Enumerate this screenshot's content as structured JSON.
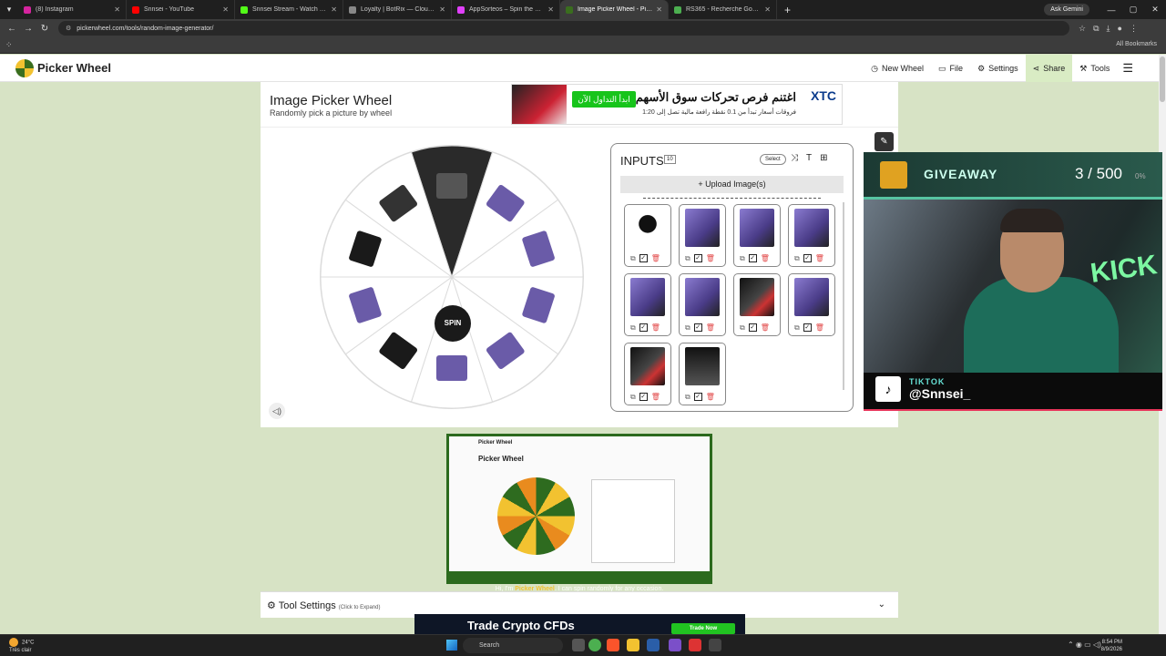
{
  "browser": {
    "tabs": [
      {
        "label": "(8) Instagram",
        "color": "#d6249f"
      },
      {
        "label": "Snnsei - YouTube",
        "color": "#ff0000"
      },
      {
        "label": "Snnsei Stream - Watch Live on Kick",
        "color": "#53fc18"
      },
      {
        "label": "Loyalty | BotRix — Cloud Stream Bot",
        "color": "#888888"
      },
      {
        "label": "AppSorteos – Spin the Wheel Online",
        "color": "#e040fb"
      },
      {
        "label": "Image Picker Wheel - Pick a Random Image",
        "color": "#3a6e1e"
      },
      {
        "label": "RS365 - Recherche Google",
        "color": "#4caf50"
      }
    ],
    "active_tab": 5,
    "ask_gemini": "Ask Gemini",
    "url": "pickerwheel.com/tools/random-image-generator/",
    "all_bookmarks": "All Bookmarks"
  },
  "site": {
    "logo": "Picker Wheel",
    "menu": [
      {
        "label": "New Wheel",
        "icon": "history-icon"
      },
      {
        "label": "File",
        "icon": "file-icon"
      },
      {
        "label": "Settings",
        "icon": "gear-icon"
      },
      {
        "label": "Share",
        "icon": "share-icon"
      },
      {
        "label": "Tools",
        "icon": "tools-icon"
      }
    ]
  },
  "page": {
    "title": "Image Picker Wheel",
    "subtitle": "Randomly pick a picture by wheel"
  },
  "ad_top": {
    "button": "ابدأ التداول الآن",
    "headline": "اغتنم فرص تحركات سوق الأسهم",
    "sub": "فروقات أسعار تبدأ من 0.1 نقطة  رافعة مالية تصل إلى 1:20",
    "brand": "XTC"
  },
  "wheel": {
    "spin_label": "SPIN",
    "segments": 10,
    "highlighted_segment": 0
  },
  "inputs": {
    "title": "INPUTS",
    "count": "10",
    "select_label": "Select",
    "upload_label": "+ Upload Image(s)",
    "items": [
      {
        "kind": "mouse",
        "checked": true
      },
      {
        "kind": "setup",
        "checked": true
      },
      {
        "kind": "setup",
        "checked": true
      },
      {
        "kind": "setup",
        "checked": true
      },
      {
        "kind": "setup",
        "checked": true
      },
      {
        "kind": "setup",
        "checked": true
      },
      {
        "kind": "pc",
        "checked": true
      },
      {
        "kind": "setup",
        "checked": true
      },
      {
        "kind": "pc",
        "checked": true
      },
      {
        "kind": "mouse-box",
        "checked": true
      }
    ]
  },
  "giveaway": {
    "label": "GIVEAWAY",
    "count": "3 / 500",
    "percent": "0%",
    "progress": 0.006
  },
  "tiktok": {
    "platform": "TIKTOK",
    "handle": "@Snnsei_"
  },
  "video": {
    "logo": "Picker Wheel",
    "title": "Picker Wheel",
    "caption_pre": "Hi, I'm ",
    "caption_brand": "Picker Wheel",
    "caption_post": ". I can spin randomly for any occasion."
  },
  "tool_settings": {
    "label": "Tool Settings",
    "hint": "(Click to Expand)"
  },
  "ad_bottom": {
    "text": "Trade Crypto CFDs",
    "button": "Trade Now"
  },
  "taskbar": {
    "temp": "24°C",
    "weather": "Très clair",
    "search": "Search",
    "time": "8:54 PM",
    "date": "8/9/2026"
  }
}
